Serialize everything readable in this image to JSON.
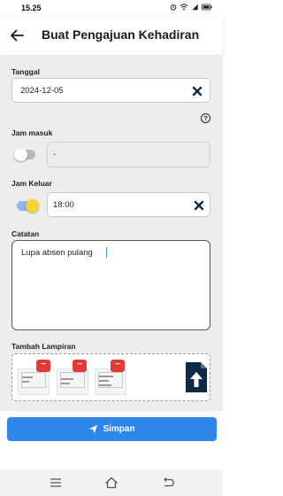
{
  "status_bar": {
    "time": "15.25"
  },
  "app_bar": {
    "title": "Buat Pengajuan Kehadiran"
  },
  "form": {
    "tanggal": {
      "label": "Tanggal",
      "value": "2024-12-05"
    },
    "jam_masuk": {
      "label": "Jam masuk",
      "value": "-",
      "enabled": false
    },
    "jam_keluar": {
      "label": "Jam Keluar",
      "value": "18:00",
      "enabled": true
    },
    "catatan": {
      "label": "Catatan",
      "value": "Lupa absen pulang"
    },
    "lampiran": {
      "label": "Tambah Lampiran",
      "delete_symbol": "−"
    },
    "help_symbol": "?"
  },
  "save_button": {
    "label": "Simpan"
  },
  "colors": {
    "primary": "#2f86ea",
    "delete": "#e53935",
    "toggle_knob_on": "#f6d233"
  }
}
